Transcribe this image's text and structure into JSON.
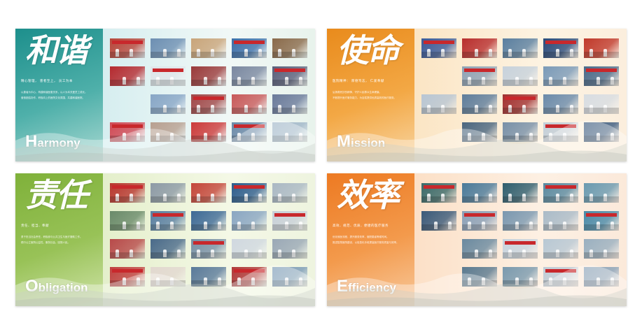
{
  "panels": [
    {
      "id": "harmony",
      "cn_title": "和谐",
      "en_cap": "H",
      "en_rest": "armony",
      "motto": "精心管理， 患者至上， 员工为本",
      "desc": [
        "以患者为中心，构建和谐医患关系，以人为本关爱员工成长。",
        "营造团结协作、积极向上的医院文化氛围，共建和谐医院。"
      ],
      "photo_colors": [
        "#b8463a",
        "#6d8fb2",
        "#c9a57a",
        "#3d6fa8",
        "#8a6a4a",
        "#b52a2f",
        "#e0e6ea",
        "#9a3a3a",
        "#7a88a0",
        "#5a5f7a",
        "#c23a3a",
        "#88a6c6",
        "#a04848",
        "#c85a5a",
        "#6a7a9a",
        "#d14a55",
        "#b8a090",
        "#cc3b3b",
        "#6c8aa8",
        "#a0b6c8"
      ],
      "empty": [
        10
      ]
    },
    {
      "id": "mission",
      "cn_title": "使命",
      "en_cap": "M",
      "en_rest": "ission",
      "motto": "医院精神： 厚德笃志， 仁爱奉献",
      "desc": [
        "弘扬救死扶伤精神，守护人民群众生命健康。",
        "不断提升医疗服务能力，为百姓提供优质高效的医疗服务。"
      ],
      "photo_colors": [
        "#3a5a9a",
        "#b82e2e",
        "#5a7fa0",
        "#2a4a7a",
        "#c0392b",
        "#6b8cae",
        "#8ea2b6",
        "#c7d2dc",
        "#7a9ab8",
        "#4a6a8a",
        "#b8c6d4",
        "#5e7d9c",
        "#a03030",
        "#6a8aaa",
        "#d8dde2",
        "#9ab0c4",
        "#4a6680",
        "#7890a8",
        "#c4cfd8",
        "#3c5c80"
      ],
      "empty": [
        5,
        15
      ]
    },
    {
      "id": "obligation",
      "cn_title": "责任",
      "en_cap": "O",
      "en_rest": "bligation",
      "motto": "责任、担当、奉献",
      "desc": [
        "勇于担当社会责任，积极参与公共卫生与医疗援助工作。",
        "践行公立医院公益性，服务社会，回馈人民。"
      ],
      "photo_colors": [
        "#b8362f",
        "#8d9aa6",
        "#c4463a",
        "#2d5c8c",
        "#aab8c4",
        "#6a8a6a",
        "#5a7fa2",
        "#3e6a96",
        "#8aa6c2",
        "#c8d0d8",
        "#b84a4a",
        "#4a6a8a",
        "#7890a6",
        "#d0d8e0",
        "#9aa8b6",
        "#c04040",
        "#e2d8d0",
        "#5a7a9a",
        "#b03a3a",
        "#7a9ab6"
      ],
      "empty": []
    },
    {
      "id": "efficiency",
      "cn_title": "效率",
      "en_cap": "E",
      "en_rest": "fficiency",
      "motto": "高效、规范、优质、便捷的医疗服务",
      "desc": [
        "优化就医流程，提升服务效率，缩短患者等候时间。",
        "推进智慧医院建设，以信息化手段提高医疗服务质量与效率。"
      ],
      "photo_colors": [
        "#3a6a6a",
        "#4a7a9a",
        "#2f5e6e",
        "#5a8aa0",
        "#6a9ab0",
        "#3a5a7a",
        "#8aa0b8",
        "#7a98b0",
        "#aabbc8",
        "#4a8aa8",
        "#d0d8e0",
        "#6a8aa0",
        "#c8d4de",
        "#b8c8d4",
        "#9ab0c0",
        "#e0e6ea",
        "#5a7a90",
        "#7a9aae",
        "#c0ccd6",
        "#8aa2b8"
      ],
      "empty": [
        10,
        15
      ]
    }
  ]
}
